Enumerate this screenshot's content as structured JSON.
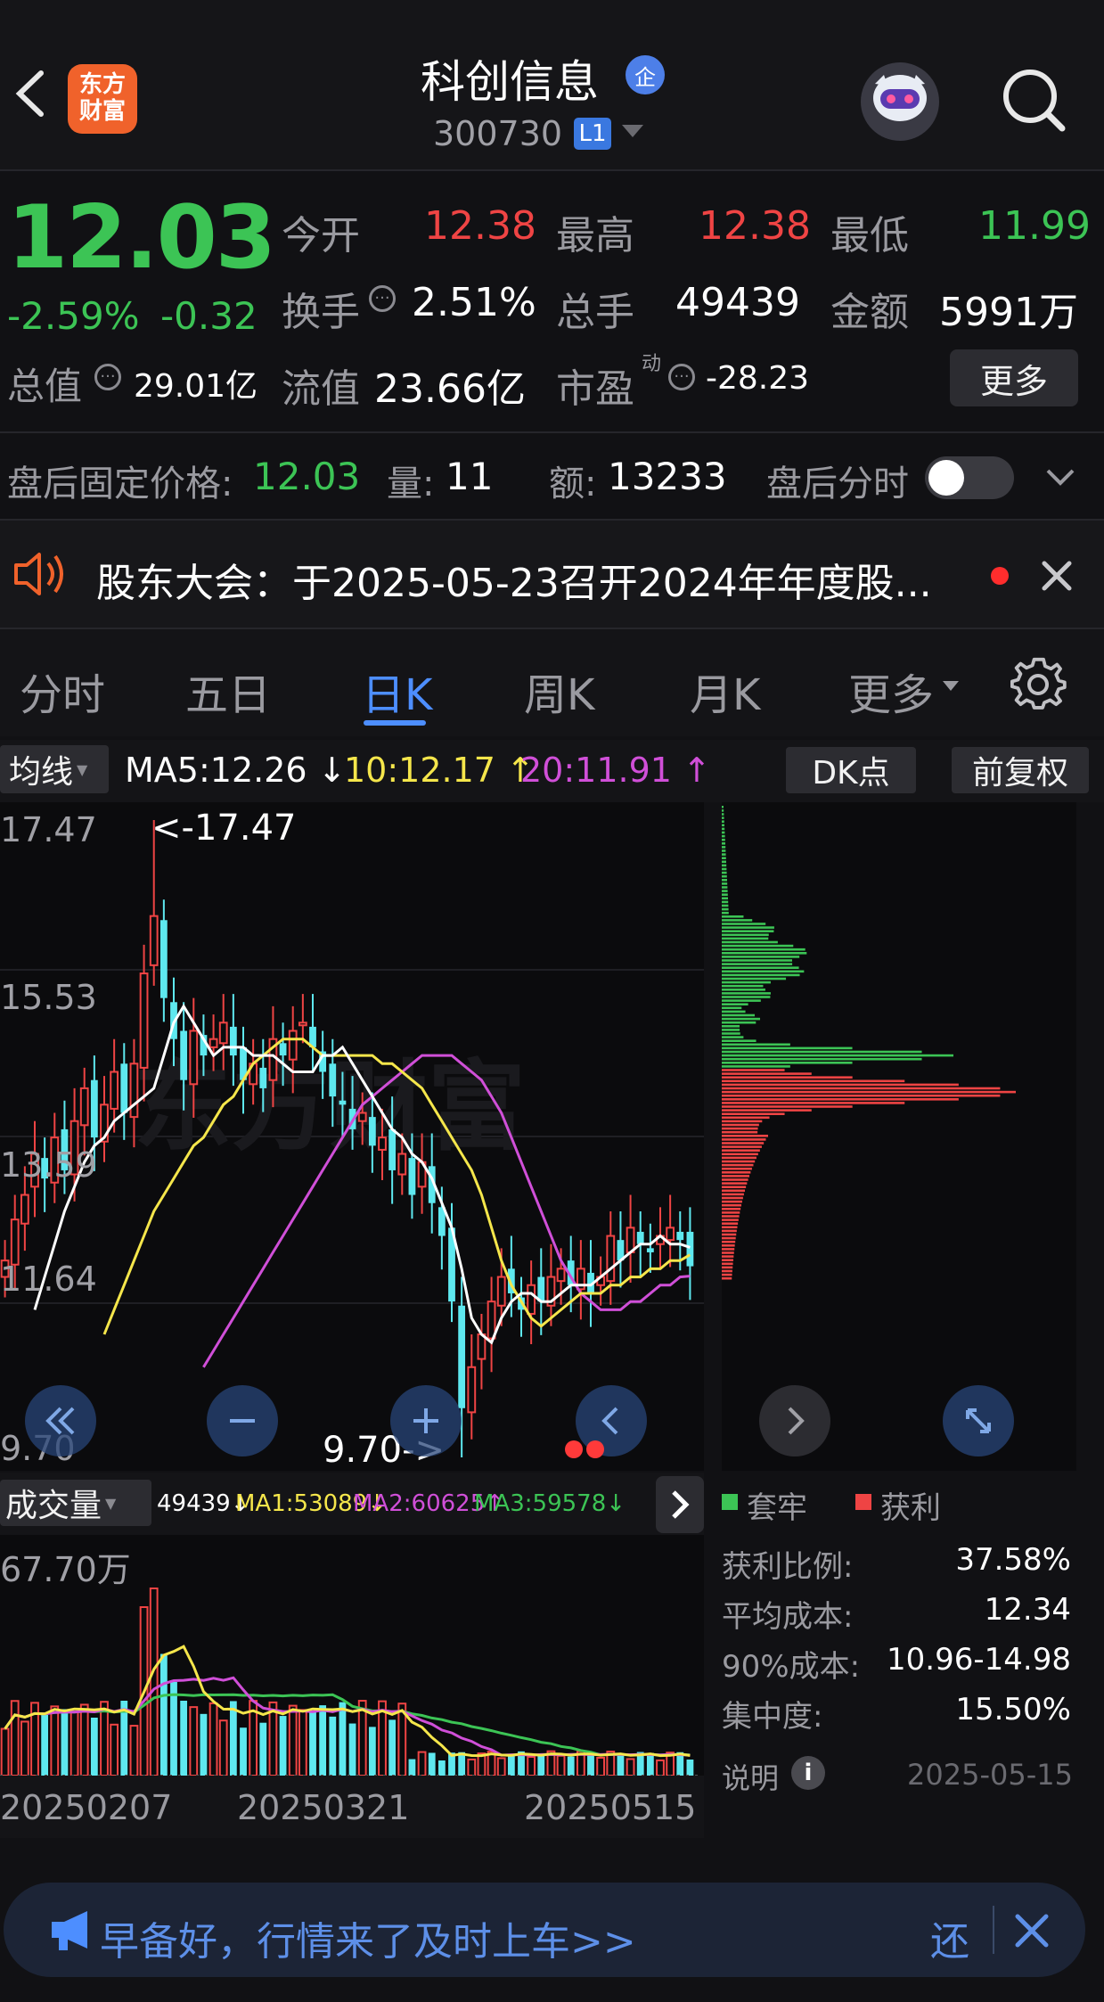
{
  "header": {
    "back_icon": "chevron-left-icon",
    "logo_text_line1": "东方",
    "logo_text_line2": "财富",
    "title": "科创信息",
    "title_badge": "企",
    "code": "300730",
    "level_badge": "L1",
    "search_icon": "search-icon"
  },
  "quote": {
    "price": "12.03",
    "change_pct": "-2.59%",
    "change": "-0.32",
    "rows": [
      {
        "label": "今开",
        "value": "12.38"
      },
      {
        "label": "最高",
        "value": "12.38"
      },
      {
        "label": "最低",
        "value": "11.99"
      },
      {
        "label": "换手",
        "value": "2.51%"
      },
      {
        "label": "总手",
        "value": "49439"
      },
      {
        "label": "金额",
        "value": "5991万"
      }
    ],
    "total_value_label": "总值",
    "total_value": "29.01亿",
    "float_value_label": "流值",
    "float_value": "23.66亿",
    "pe_label": "市盈",
    "pe_sup": "动",
    "pe_value": "-28.23",
    "more_button": "更多"
  },
  "after_hours": {
    "price_label": "盘后固定价格:",
    "price": "12.03",
    "vol_label": "量:",
    "vol": "11",
    "amount_label": "额:",
    "amount": "13233",
    "timeshare_label": "盘后分时"
  },
  "notice": {
    "text": "股东大会：于2025-05-23召开2024年年度股..."
  },
  "tabs": [
    "分时",
    "五日",
    "日K",
    "周K",
    "月K",
    "更多"
  ],
  "active_tab": "日K",
  "ma_bar": {
    "selector": "均线",
    "ma5": "MA5:12.26",
    "ma5_arrow": "↓",
    "ma10": "10:12.17",
    "ma10_arrow": "↑",
    "ma20": "20:11.91",
    "ma20_arrow": "↑",
    "dk_button": "DK点",
    "adjust_button": "前复权"
  },
  "chart_data": {
    "type": "candlestick",
    "y_labels": [
      "17.47",
      "15.53",
      "13.59",
      "11.64",
      "9.70"
    ],
    "high_annotation": "<-17.47",
    "low_annotation": "9.70->",
    "ylim": [
      9.7,
      17.47
    ],
    "x_labels": [
      "20250207",
      "20250321",
      "20250515"
    ],
    "close_series": [
      12.1,
      12.6,
      12.9,
      13.4,
      13.1,
      13.6,
      13.2,
      13.8,
      14.2,
      13.6,
      14.0,
      14.4,
      13.9,
      14.5,
      15.6,
      16.3,
      15.3,
      14.8,
      14.3,
      14.9,
      14.6,
      14.8,
      15.0,
      14.6,
      14.3,
      14.5,
      14.2,
      14.8,
      14.6,
      14.9,
      15.0,
      14.7,
      14.4,
      14.1,
      14.0,
      13.7,
      13.9,
      13.5,
      13.6,
      13.2,
      13.4,
      12.9,
      13.3,
      12.8,
      12.4,
      11.6,
      10.3,
      10.8,
      11.2,
      11.6,
      11.9,
      11.7,
      11.5,
      11.8,
      11.6,
      11.9,
      12.0,
      11.8,
      12.0,
      11.7,
      11.9,
      12.4,
      12.1,
      12.5,
      12.3,
      12.2,
      12.4,
      12.5,
      12.35,
      12.03
    ],
    "ma5_series": [
      11.5,
      11.9,
      12.3,
      12.7,
      13.0,
      13.3,
      13.5,
      13.6,
      13.8,
      13.9,
      14.0,
      14.1,
      14.2,
      14.6,
      15.0,
      15.2,
      15.0,
      14.8,
      14.6,
      14.7,
      14.7,
      14.7,
      14.6,
      14.6,
      14.6,
      14.5,
      14.4,
      14.4,
      14.4,
      14.6,
      14.6,
      14.7,
      14.5,
      14.3,
      14.1,
      13.9,
      13.7,
      13.6,
      13.4,
      13.3,
      13.1,
      12.8,
      12.5,
      12.0,
      11.4,
      11.2,
      11.1,
      11.4,
      11.6,
      11.7,
      11.7,
      11.6,
      11.6,
      11.7,
      11.8,
      11.8,
      11.8,
      11.9,
      12.0,
      12.1,
      12.2,
      12.3,
      12.3,
      12.4,
      12.3,
      12.3,
      12.26
    ],
    "ma10_series": [
      11.2,
      11.5,
      11.8,
      12.1,
      12.4,
      12.7,
      12.9,
      13.1,
      13.3,
      13.5,
      13.6,
      13.8,
      14.0,
      14.1,
      14.3,
      14.5,
      14.6,
      14.7,
      14.8,
      14.8,
      14.8,
      14.7,
      14.6,
      14.6,
      14.6,
      14.6,
      14.6,
      14.6,
      14.5,
      14.5,
      14.4,
      14.3,
      14.2,
      14.0,
      13.8,
      13.6,
      13.4,
      13.2,
      12.9,
      12.5,
      12.1,
      11.8,
      11.6,
      11.4,
      11.3,
      11.4,
      11.5,
      11.6,
      11.7,
      11.7,
      11.7,
      11.8,
      11.8,
      11.9,
      11.9,
      12.0,
      12.0,
      12.1,
      12.1,
      12.17
    ],
    "ma20_series": [
      10.8,
      11.0,
      11.2,
      11.4,
      11.6,
      11.8,
      12.0,
      12.2,
      12.4,
      12.6,
      12.8,
      13.0,
      13.2,
      13.4,
      13.6,
      13.8,
      14.0,
      14.1,
      14.2,
      14.3,
      14.4,
      14.5,
      14.6,
      14.6,
      14.6,
      14.6,
      14.5,
      14.4,
      14.3,
      14.1,
      13.9,
      13.6,
      13.3,
      13.0,
      12.7,
      12.4,
      12.1,
      11.9,
      11.7,
      11.6,
      11.5,
      11.5,
      11.5,
      11.6,
      11.6,
      11.7,
      11.8,
      11.8,
      11.9,
      11.91
    ]
  },
  "chip": {
    "legend_trapped": "套牢",
    "legend_profit": "获利",
    "stats": [
      {
        "label": "获利比例:",
        "value": "37.58%"
      },
      {
        "label": "平均成本:",
        "value": "12.34"
      },
      {
        "label": "90%成本:",
        "value": "10.96-14.98"
      },
      {
        "label": "集中度:",
        "value": "15.50%"
      }
    ],
    "note_label": "说明",
    "date": "2025-05-15"
  },
  "volume": {
    "selector": "成交量",
    "vol": "49439",
    "ma1": "MA1:53089",
    "ma2": "MA2:60625",
    "ma3": "MA3:59578",
    "max_label": "67.70万"
  },
  "banner": {
    "text": "早备好，行情来了及时上车>>",
    "right_text": "还"
  },
  "colors": {
    "up": "#ef4444",
    "down": "#5ee8ef",
    "ma5": "#ffffff",
    "ma10": "#f5e64b",
    "ma20": "#d04fd8",
    "accent_blue": "#4d8eff"
  }
}
